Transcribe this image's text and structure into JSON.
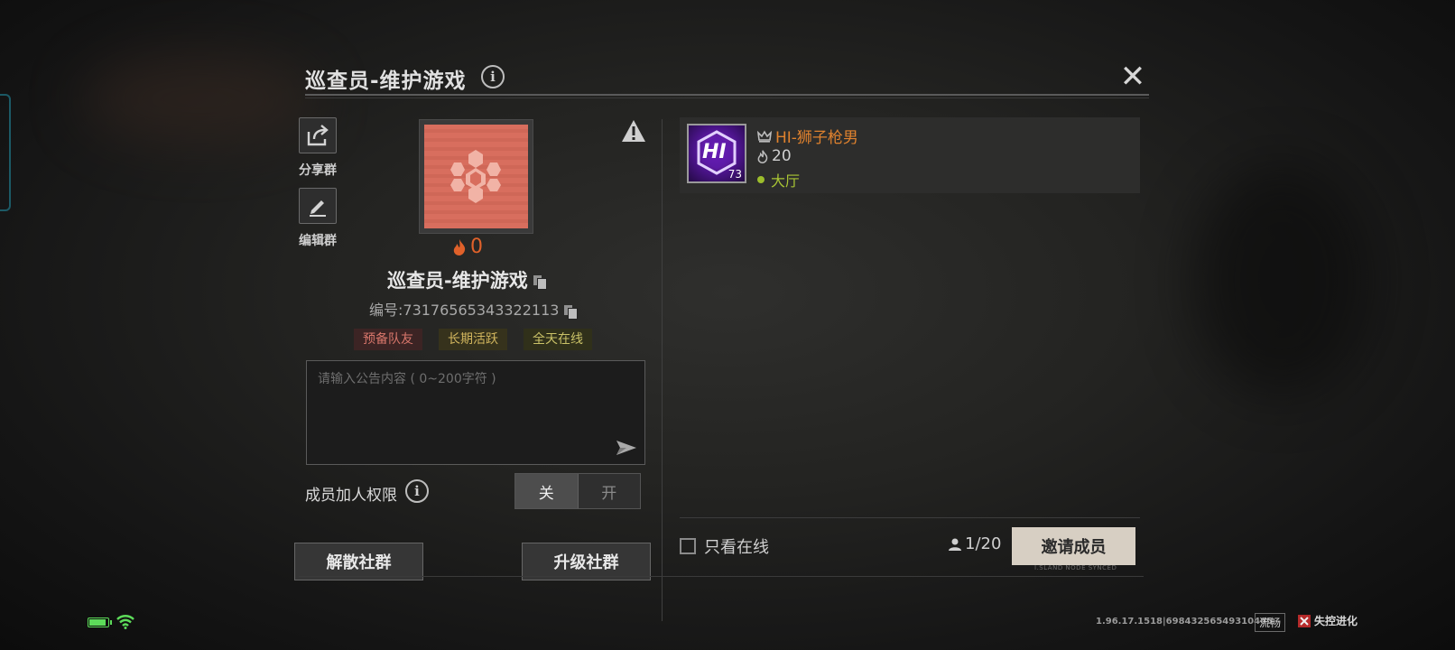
{
  "dialog": {
    "title": "巡查员-维护游戏",
    "close_glyph": "✕",
    "info_glyph": "i"
  },
  "actions": {
    "share_label": "分享群",
    "edit_label": "编辑群"
  },
  "group": {
    "heat": "0",
    "name": "巡查员-维护游戏",
    "id_text": "编号:73176565343322113",
    "tags": [
      "预备队友",
      "长期活跃",
      "全天在线"
    ]
  },
  "notice": {
    "placeholder": "请输入公告内容 ( 0~200字符 )",
    "value": ""
  },
  "permission": {
    "label": "成员加人权限",
    "off_label": "关",
    "on_label": "开",
    "selected": "关"
  },
  "buttons": {
    "disband": "解散社群",
    "upgrade": "升级社群",
    "invite": "邀请成员"
  },
  "members": [
    {
      "badge_text": "HI",
      "level": "73",
      "name": "HI-狮子枪男",
      "heat": "20",
      "status": "大厅"
    }
  ],
  "filter": {
    "online_only_label": "只看在线",
    "count": "1/20"
  },
  "footer": {
    "island_text": "I.SLAND NODE SYNCED"
  },
  "status_bar": {
    "battery_level": 0.8,
    "version": "1.96.17.1518|69843256549310465",
    "network": "流畅",
    "game_name": "失控进化"
  },
  "colors": {
    "heat_orange": "#e0612a",
    "member_name": "#e0822e",
    "online_green": "#9cbd2c",
    "invite_button": "#d7cfc3",
    "group_avatar": "#d86e5e"
  },
  "icons": [
    "share-icon",
    "edit-icon",
    "warning-icon",
    "fire-icon",
    "copy-icon",
    "send-icon",
    "info-icon",
    "close-icon",
    "crown-icon",
    "person-icon",
    "snowflake-icon",
    "battery-icon",
    "wifi-icon"
  ]
}
